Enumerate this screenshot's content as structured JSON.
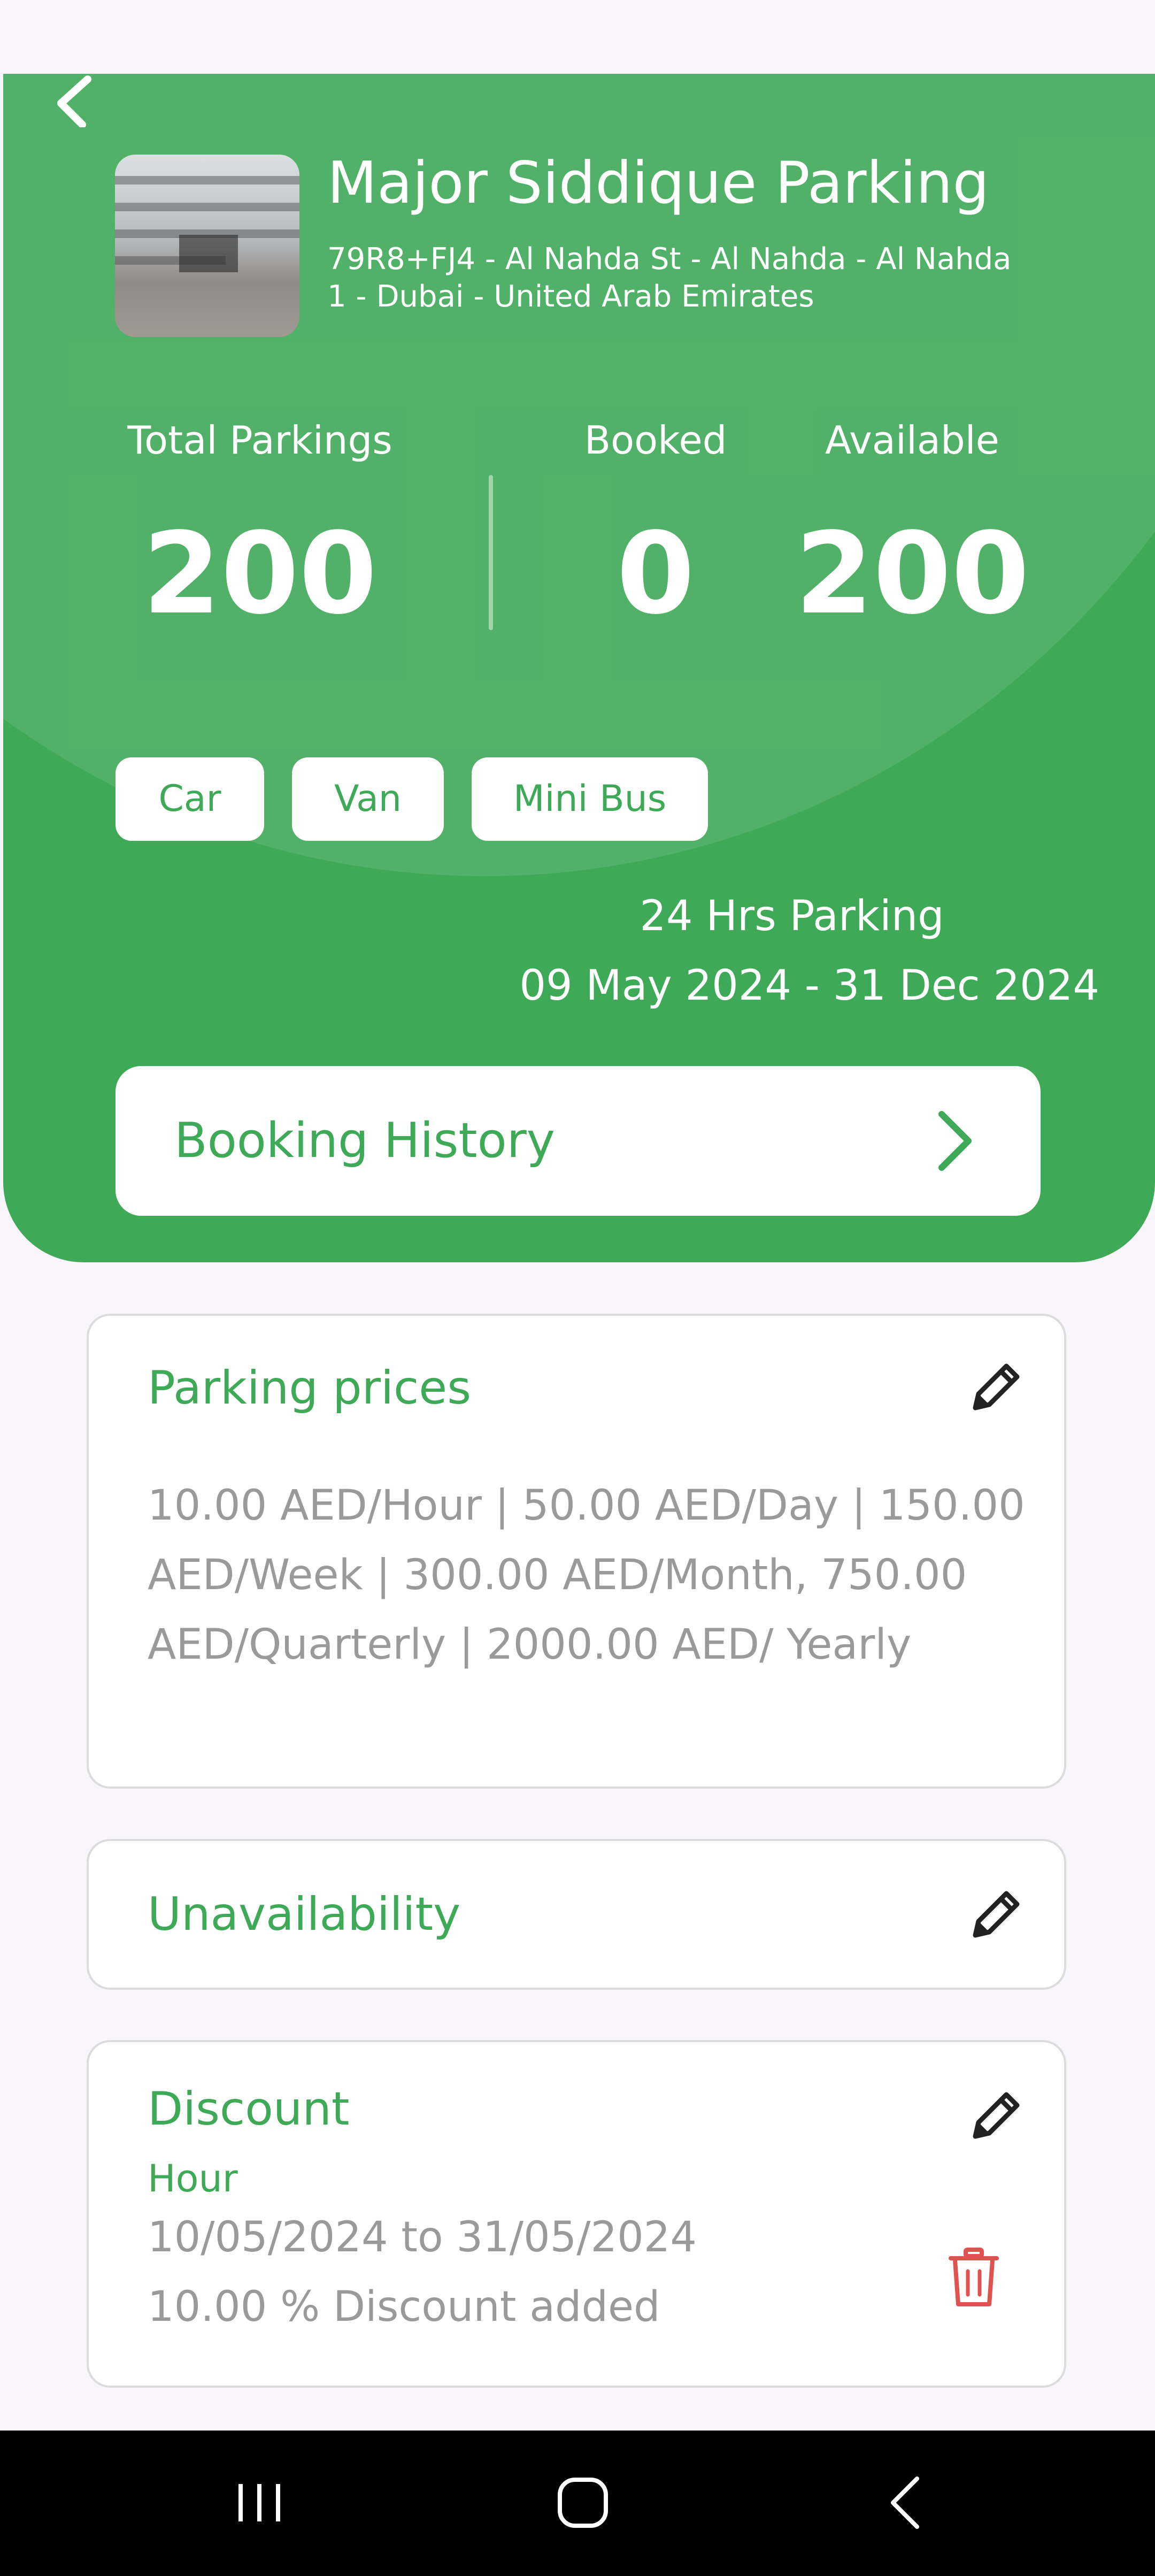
{
  "parking": {
    "name": "Major Siddique Parking",
    "address": "79R8+FJ4 - Al Nahda St - Al Nahda - Al Nahda 1 - Dubai - United Arab Emirates"
  },
  "stats": {
    "total_label": "Total Parkings",
    "total_value": "200",
    "booked_label": "Booked",
    "booked_value": "0",
    "available_label": "Available",
    "available_value": "200"
  },
  "vehicle_types": [
    "Car",
    "Van",
    "Mini Bus"
  ],
  "schedule": {
    "hours": "24 Hrs Parking",
    "date_range": "09 May 2024 - 31 Dec 2024"
  },
  "booking_history": {
    "label": "Booking History"
  },
  "prices_card": {
    "title": "Parking prices",
    "text": "10.00 AED/Hour | 50.00 AED/Day | 150.00 AED/Week | 300.00 AED/Month, 750.00 AED/Quarterly | 2000.00 AED/ Yearly"
  },
  "unavailability_card": {
    "title": "Unavailability"
  },
  "discount_card": {
    "title": "Discount",
    "unit": "Hour",
    "period": "10/05/2024  to  31/05/2024",
    "description": "10.00 % Discount added"
  },
  "icons": {
    "back": "chevron-left-icon",
    "history": "chevron-right-icon",
    "edit": "pencil-icon",
    "delete": "trash-icon",
    "nav_recents": "recents-icon",
    "nav_home": "home-icon",
    "nav_back": "back-icon"
  },
  "colors": {
    "primary": "#3ea957",
    "delete": "#e0524f",
    "muted_text": "#9a9a9a"
  }
}
